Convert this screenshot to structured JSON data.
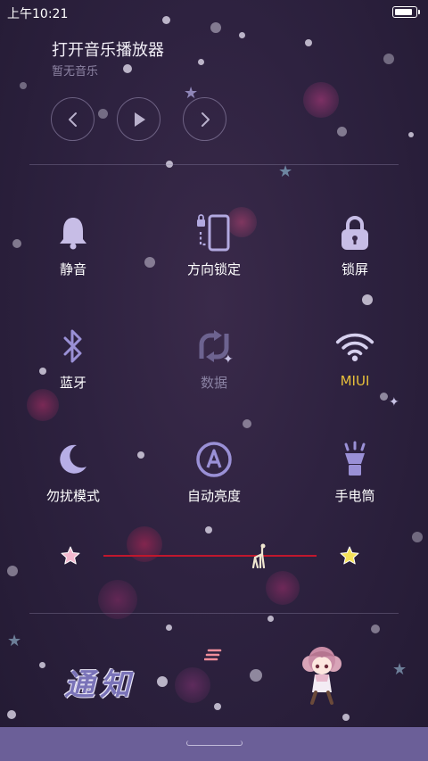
{
  "status_bar": {
    "time": "上午10:21",
    "battery_level": 0.9
  },
  "music": {
    "title": "打开音乐播放器",
    "subtitle": "暂无音乐",
    "controls": [
      "previous-icon",
      "play-icon",
      "next-icon"
    ]
  },
  "toggles": [
    {
      "label": "静音",
      "icon": "bell-icon",
      "state": "on"
    },
    {
      "label": "方向锁定",
      "icon": "rotation-lock-icon",
      "state": "on"
    },
    {
      "label": "锁屏",
      "icon": "lock-icon",
      "state": "on"
    },
    {
      "label": "蓝牙",
      "icon": "bluetooth-icon",
      "state": "on"
    },
    {
      "label": "数据",
      "icon": "mobile-data-icon",
      "state": "off"
    },
    {
      "label": "MIUI",
      "icon": "wifi-icon",
      "state": "connected"
    },
    {
      "label": "勿扰模式",
      "icon": "moon-icon",
      "state": "on"
    },
    {
      "label": "自动亮度",
      "icon": "auto-brightness-icon",
      "state": "on"
    },
    {
      "label": "手电筒",
      "icon": "flashlight-icon",
      "state": "on"
    }
  ],
  "brightness": {
    "level": 0.73,
    "min_icon": "star-pink-icon",
    "max_icon": "star-yellow-icon"
  },
  "notification": {
    "banner_art": "通知",
    "clear_icon": "clear-notifications-icon"
  },
  "colors": {
    "accent": "#e8c03a",
    "icon_active": "#b9b1e6",
    "icon_inactive": "#7d739e",
    "slider": "#c0172d",
    "bottom_bar": "#6b5f98"
  }
}
